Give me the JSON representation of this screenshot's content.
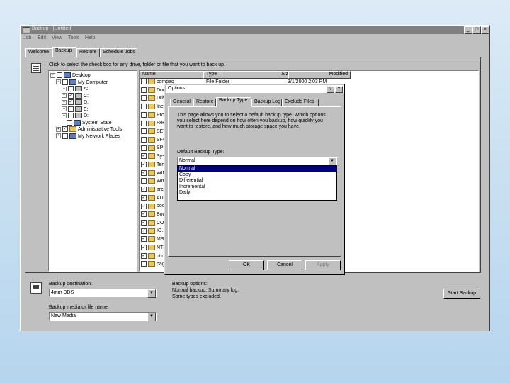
{
  "window": {
    "title": "Backup - [Untitled]",
    "minimize": "_",
    "maximize": "□",
    "close": "×"
  },
  "menu": [
    "Job",
    "Edit",
    "View",
    "Tools",
    "Help"
  ],
  "tabs": [
    "Welcome",
    "Backup",
    "Restore",
    "Schedule Jobs"
  ],
  "instruction": "Click to select the check box for any drive, folder or file that you want to back up.",
  "tree": [
    {
      "label": "Desktop",
      "expander": "-",
      "checked": false,
      "icon": "desktop-icon"
    },
    {
      "label": "My Computer",
      "expander": "-",
      "checked": false,
      "icon": "computer-icon"
    },
    {
      "label": "A:",
      "expander": "+",
      "checked": false,
      "icon": "drive-icon"
    },
    {
      "label": "C:",
      "expander": "+",
      "checked": true,
      "icon": "drive-icon"
    },
    {
      "label": "D:",
      "expander": "+",
      "checked": true,
      "icon": "drive-icon"
    },
    {
      "label": "E:",
      "expander": "+",
      "checked": false,
      "icon": "drive-icon"
    },
    {
      "label": "D:",
      "expander": "+",
      "checked": false,
      "icon": "drive-icon"
    },
    {
      "label": "System State",
      "expander": "",
      "checked": false,
      "icon": "system-icon"
    },
    {
      "label": "Administrative Tools",
      "expander": "+",
      "checked": true,
      "icon": "folder-icon"
    },
    {
      "label": "My Network Places",
      "expander": "+",
      "checked": false,
      "icon": "network-icon"
    }
  ],
  "columns": [
    "Name",
    "Type",
    "Size",
    "Modified"
  ],
  "files": [
    {
      "name": "compaq",
      "type": "File Folder",
      "modified": "3/1/2000 2:03 PM",
      "checked": false
    },
    {
      "name": "Documents",
      "type": "",
      "modified": "",
      "checked": false
    },
    {
      "name": "Drivers",
      "type": "",
      "modified": "",
      "checked": false
    },
    {
      "name": "Inetpub",
      "type": "",
      "modified": "",
      "checked": false
    },
    {
      "name": "Program Files",
      "type": "",
      "modified": "",
      "checked": false
    },
    {
      "name": "Recycler",
      "type": "",
      "modified": "",
      "checked": false
    },
    {
      "name": "SETUP",
      "type": "",
      "modified": "",
      "checked": false
    },
    {
      "name": "SFU",
      "type": "",
      "modified": "",
      "checked": false
    },
    {
      "name": "SPL",
      "type": "",
      "modified": "",
      "checked": false
    },
    {
      "name": "System Volume",
      "type": "",
      "modified": "",
      "checked": true
    },
    {
      "name": "Temp",
      "type": "",
      "modified": "",
      "checked": true
    },
    {
      "name": "WINNT",
      "type": "",
      "modified": "",
      "checked": true
    },
    {
      "name": "Wmpub",
      "type": "",
      "modified": "",
      "checked": false
    },
    {
      "name": "arcldr.exe",
      "type": "",
      "modified": "",
      "checked": true
    },
    {
      "name": "AUTOEXEC.BAT",
      "type": "",
      "modified": "",
      "checked": true
    },
    {
      "name": "boot.ini",
      "type": "",
      "modified": "",
      "checked": true
    },
    {
      "name": "Bootfont.bin",
      "type": "",
      "modified": "",
      "checked": true
    },
    {
      "name": "CONFIG.SYS",
      "type": "",
      "modified": "",
      "checked": true
    },
    {
      "name": "IO.SYS",
      "type": "",
      "modified": "",
      "checked": true
    },
    {
      "name": "MSDOS.SYS",
      "type": "",
      "modified": "",
      "checked": true
    },
    {
      "name": "NTDETECT.COM",
      "type": "",
      "modified": "",
      "checked": true
    },
    {
      "name": "ntldr",
      "type": "",
      "modified": "",
      "checked": true
    },
    {
      "name": "pagefile.sys",
      "type": "",
      "modified": "",
      "checked": false
    }
  ],
  "bottom": {
    "destination_label": "Backup destination:",
    "destination_value": "4mm DDS",
    "media_label": "Backup media or file name:",
    "media_value": "New Media",
    "options_label": "Backup options:",
    "options_line1": "Normal backup. Summary log.",
    "options_line2": "Some types excluded.",
    "start_button": "Start Backup"
  },
  "dialog": {
    "title": "Options",
    "help": "?",
    "close": "×",
    "tabs": [
      "General",
      "Restore",
      "Backup Type",
      "Backup Log",
      "Exclude Files"
    ],
    "description": "This page allows you to select a default backup type. Which options you select here depend on how often you backup, how quickly you want to restore, and how much storage space you have.",
    "default_label": "Default Backup Type:",
    "selected": "Normal",
    "options": [
      "Normal",
      "Copy",
      "Differential",
      "Incremental",
      "Daily"
    ],
    "ok": "OK",
    "cancel": "Cancel",
    "apply": "Apply"
  }
}
